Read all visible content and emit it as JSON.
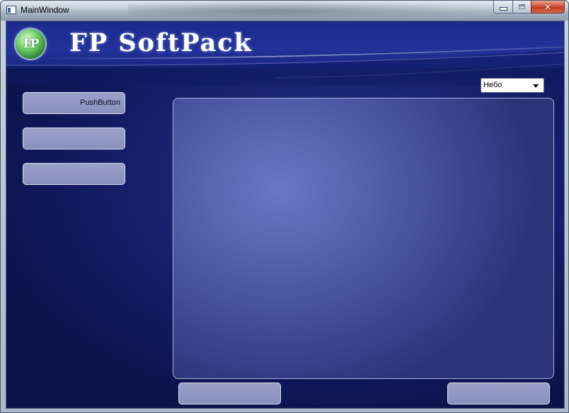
{
  "window": {
    "title": "MainWindow",
    "controls": {
      "minimize": "minimize-icon",
      "maximize": "maximize-icon",
      "close": "close-icon"
    }
  },
  "header": {
    "logo_letters": "FP",
    "brand_title": "FP SoftPack"
  },
  "left_buttons": [
    {
      "label": "PushButton"
    },
    {
      "label": ""
    },
    {
      "label": ""
    }
  ],
  "combo": {
    "selected": "Небо"
  },
  "bottom_buttons": [
    {
      "label": ""
    },
    {
      "label": ""
    }
  ],
  "colors": {
    "background": "#0f185a",
    "header": "#1b2a8c",
    "panel": "#5560ad",
    "button": "#9aa0c8",
    "close_button": "#c23a21"
  }
}
